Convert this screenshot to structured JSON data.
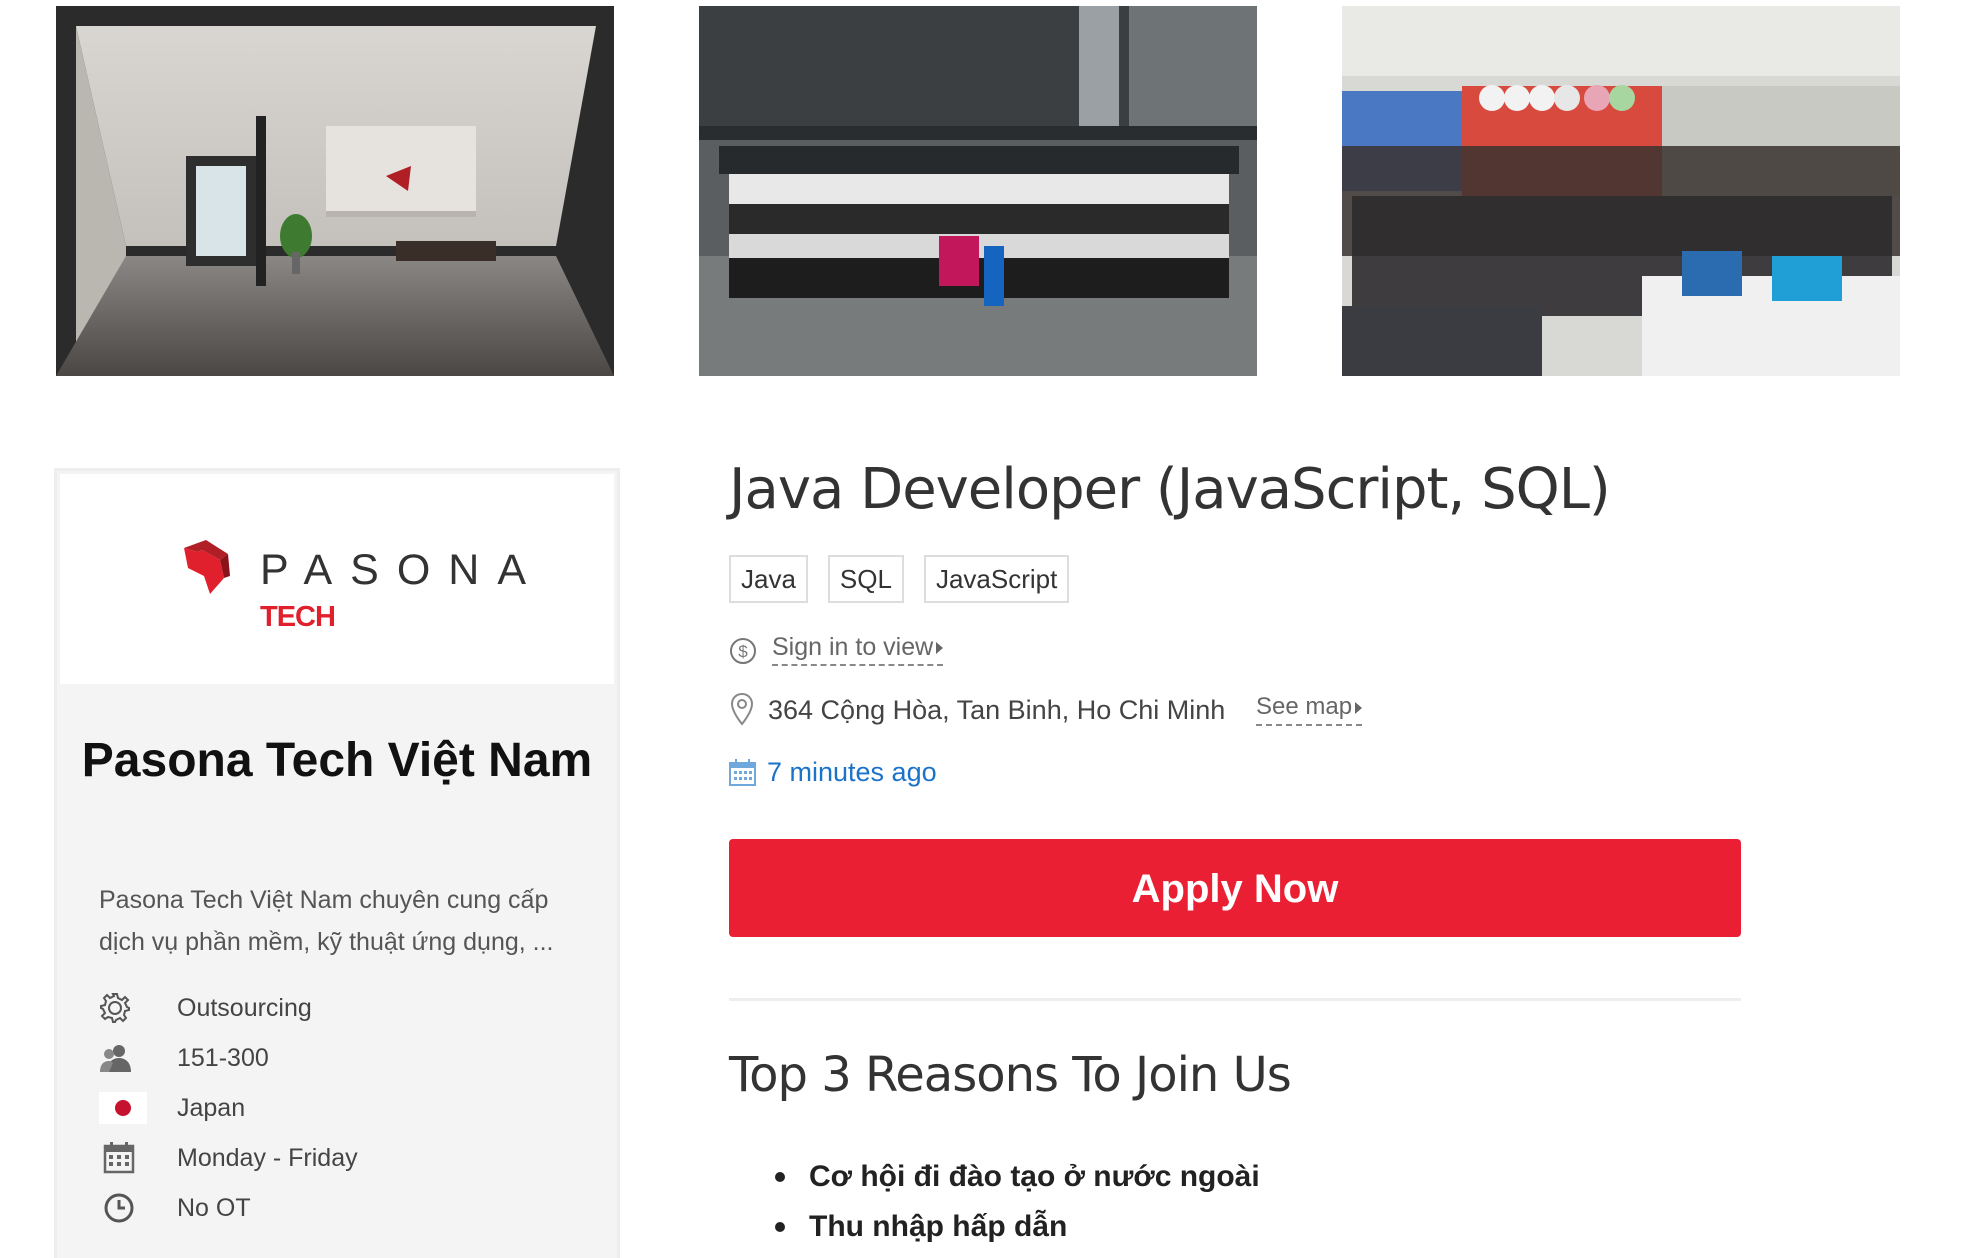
{
  "photos": [
    {
      "name": "office-lobby-photo",
      "icon": "office-reception-image"
    },
    {
      "name": "group-photo-outdoor",
      "icon": "team-group-image"
    },
    {
      "name": "group-photo-office",
      "icon": "office-party-image"
    }
  ],
  "company": {
    "logo_word": "PASONA",
    "logo_sub": "TECH",
    "name": "Pasona Tech Việt Nam",
    "description": "Pasona Tech Việt Nam chuyên cung cấp dịch vụ phần mềm, kỹ thuật ứng dụng, ...",
    "facts": [
      {
        "icon": "gear-icon",
        "label": "Outsourcing"
      },
      {
        "icon": "people-icon",
        "label": "151-300"
      },
      {
        "icon": "japan-flag-icon",
        "label": "Japan"
      },
      {
        "icon": "calendar-icon",
        "label": "Monday - Friday"
      },
      {
        "icon": "clock-icon",
        "label": "No OT"
      }
    ]
  },
  "job": {
    "title": "Java Developer (JavaScript, SQL)",
    "tags": [
      "Java",
      "SQL",
      "JavaScript"
    ],
    "salary_link": "Sign in to view",
    "address": "364 Cộng Hòa, Tan Binh, Ho Chi Minh",
    "map_link": "See map",
    "posted": "7 minutes ago",
    "apply_label": "Apply Now"
  },
  "reasons": {
    "heading": "Top 3 Reasons To Join Us",
    "items": [
      "Cơ hội đi đào tạo ở nước ngoài",
      "Thu nhập hấp dẫn"
    ]
  },
  "colors": {
    "brand_red": "#ea1f34",
    "link_blue": "#1a73c8",
    "card_bg": "#f4f4f4"
  }
}
